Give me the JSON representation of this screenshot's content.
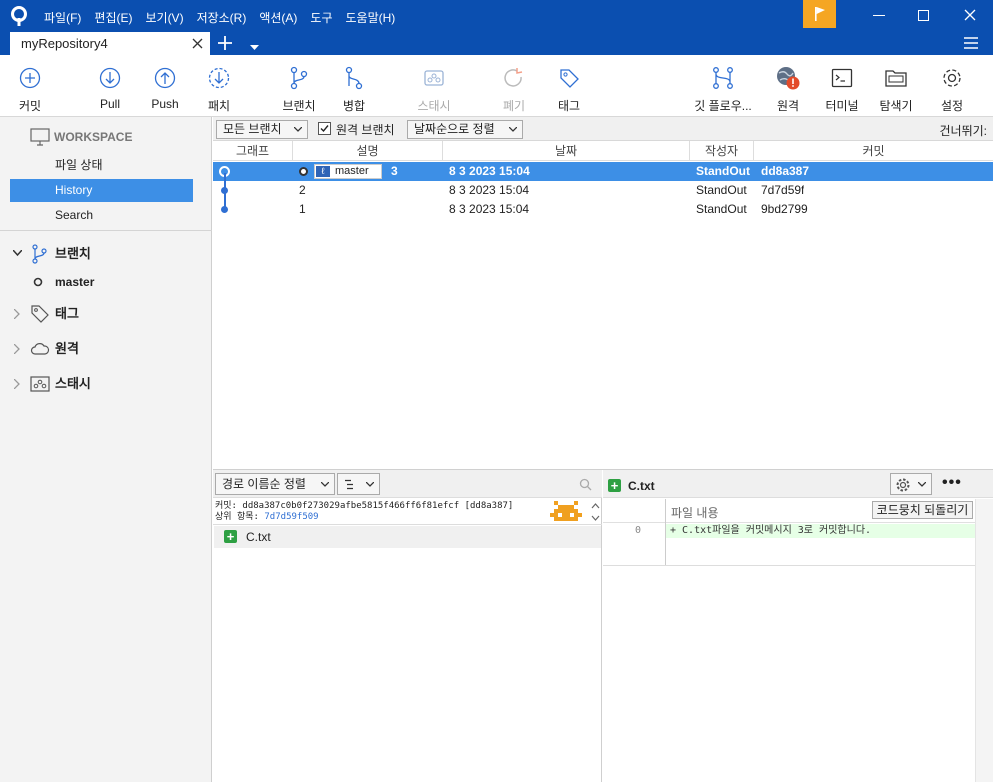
{
  "menu": [
    "파일(F)",
    "편집(E)",
    "보기(V)",
    "저장소(R)",
    "액션(A)",
    "도구",
    "도움말(H)"
  ],
  "tab": {
    "title": "myRepository4"
  },
  "toolbar": {
    "commit": "커밋",
    "pull": "Pull",
    "push": "Push",
    "fetch": "패치",
    "branch": "브랜치",
    "merge": "병합",
    "stash": "스태시",
    "discard": "폐기",
    "tag": "태그",
    "gitflow": "깃 플로우...",
    "remote": "원격",
    "terminal": "터미널",
    "explorer": "탐색기",
    "settings": "설정"
  },
  "sidebar": {
    "workspace": "WORKSPACE",
    "file_status": "파일 상태",
    "history": "History",
    "search": "Search",
    "branches": "브랜치",
    "branch_master": "master",
    "tags": "태그",
    "remotes": "원격",
    "stashes": "스태시"
  },
  "filter": {
    "all_branches": "모든 브랜치",
    "remote_branches": "원격 브랜치",
    "sort_date": "날짜순으로 정렬",
    "jump": "건너뛰기:"
  },
  "history": {
    "headers": {
      "graph": "그래프",
      "desc": "설명",
      "date": "날짜",
      "author": "작성자",
      "commit": "커밋"
    },
    "rows": [
      {
        "desc": "3",
        "branch": "master",
        "date": "8 3 2023 15:04",
        "author": "StandOut",
        "hash": "dd8a387"
      },
      {
        "desc": "2",
        "date": "8 3 2023 15:04",
        "author": "StandOut",
        "hash": "7d7d59f"
      },
      {
        "desc": "1",
        "date": "8 3 2023 15:04",
        "author": "StandOut",
        "hash": "9bd2799"
      }
    ]
  },
  "lower": {
    "sort_path": "경로 이름순 정렬",
    "commit_label": "커밋:",
    "commit_full": "dd8a387c0b0f273029afbe5815f466ff6f81efcf [dd8a387]",
    "parent_label": "상위 항목:",
    "parent": "7d7d59f509",
    "file": "C.txt"
  },
  "diff": {
    "file": "C.txt",
    "file_content": "파일 내용",
    "revert": "코드뭉치 되돌리기",
    "line_no": "0",
    "line": "+ C.txt파일을 커밋메시지 3로 커밋합니다."
  }
}
